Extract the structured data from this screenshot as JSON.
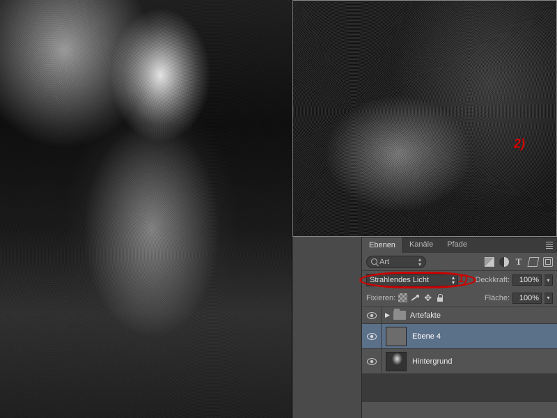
{
  "annotations": {
    "detail_number": "2)",
    "ring_number": "1)"
  },
  "panel": {
    "tabs": {
      "layers": "Ebenen",
      "channels": "Kanäle",
      "paths": "Pfade"
    },
    "search_placeholder": "Art",
    "blend_mode": "Strahlendes Licht",
    "opacity": {
      "label": "Deckkraft:",
      "value": "100%"
    },
    "lock_label": "Fixieren:",
    "fill": {
      "label": "Fläche:",
      "value": "100%"
    },
    "layers": [
      {
        "name": "Artefakte"
      },
      {
        "name": "Ebene 4"
      },
      {
        "name": "Hintergrund"
      }
    ]
  }
}
